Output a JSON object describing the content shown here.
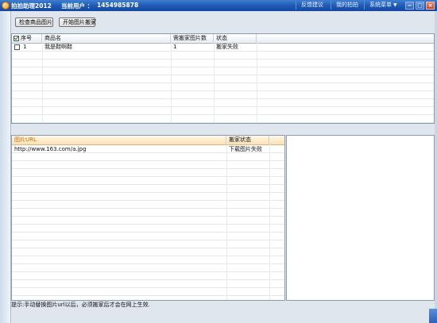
{
  "titlebar": {
    "app_title": "拍拍助理2012",
    "user_label": "当前用户 ：",
    "user_id": "1454985878",
    "links": {
      "feedback": "反馈建议",
      "my_paipai": "我的拍拍",
      "system_menu": "系统菜单"
    },
    "window_buttons": {
      "minimize": "−",
      "maximize": "□",
      "close": "×"
    }
  },
  "toolbar": {
    "check_images": "检查商品图片",
    "start_move": "开始图片搬家"
  },
  "product_table": {
    "headers": {
      "index": "序号",
      "name": "商品名",
      "count": "需搬家图片数",
      "status": "状态"
    },
    "rows": [
      {
        "checked": false,
        "index": "1",
        "name": "我是鞋啊鞋",
        "count": "1",
        "status": "搬家失败"
      }
    ]
  },
  "image_table": {
    "headers": {
      "url": "图片URL",
      "status": "搬家状态"
    },
    "rows": [
      {
        "url": "http://www.163.com/a.jpg",
        "status": "下载图片失败"
      }
    ]
  },
  "hint": "提示:手动替换图片url以后，必须搬家后才会在网上生效."
}
